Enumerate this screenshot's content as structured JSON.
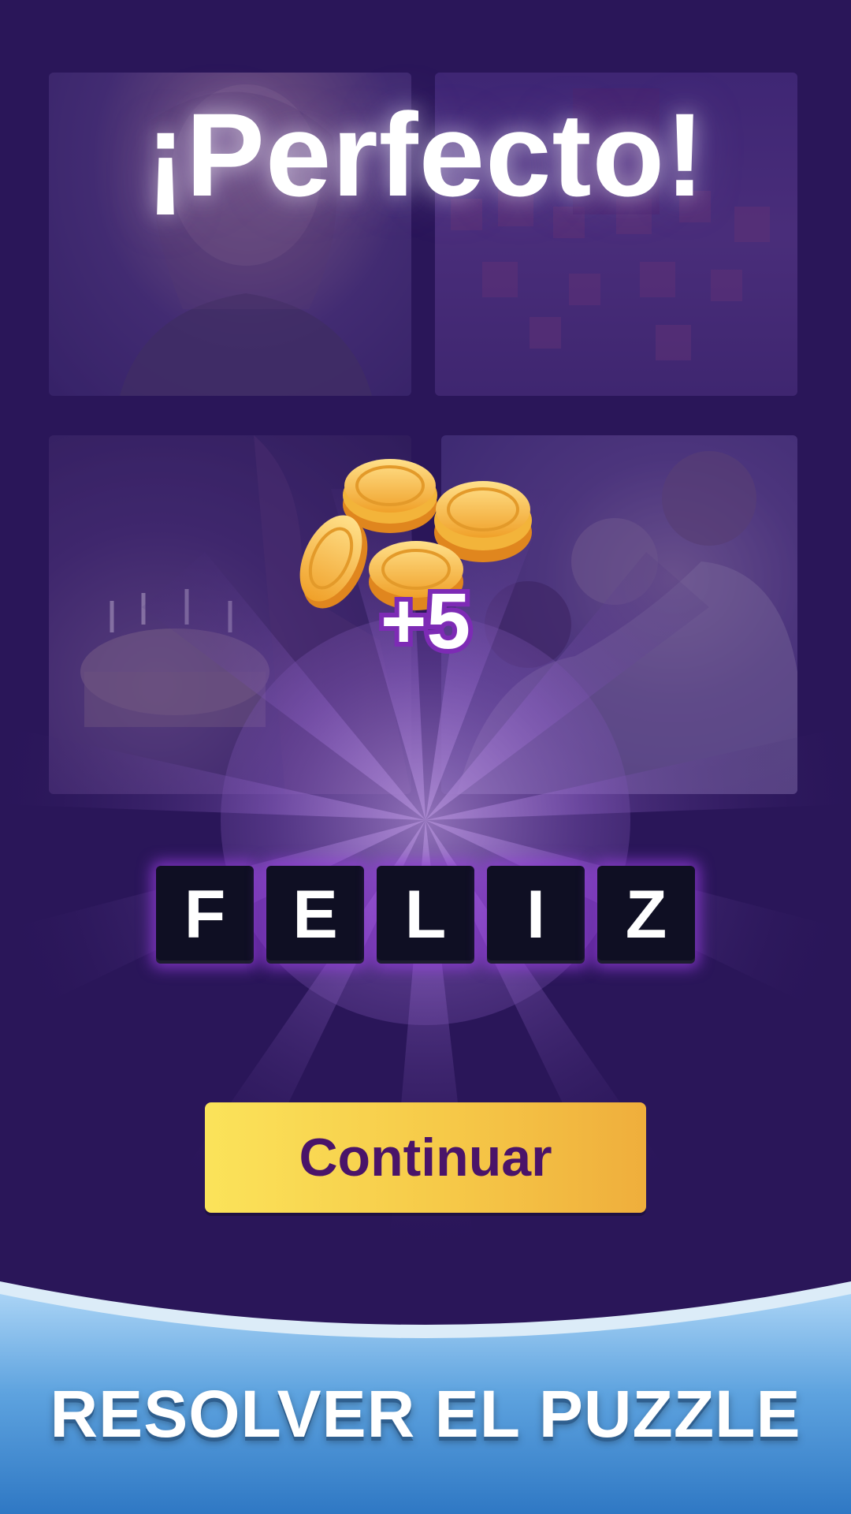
{
  "result": {
    "title": "¡Perfecto!",
    "reward_text": "+5",
    "coin_icon": "gold-coins-icon",
    "answer_letters": [
      "F",
      "E",
      "L",
      "I",
      "Z"
    ],
    "continue_label": "Continuar"
  },
  "banner": {
    "text": "RESOLVER EL PUZZLE"
  },
  "colors": {
    "background": "#2a1659",
    "button": "#f6c948",
    "button_text": "#4a1469",
    "letter_tile": "#0f0f23",
    "glow": "#963cdc",
    "banner_blue": "#3f86d0"
  }
}
